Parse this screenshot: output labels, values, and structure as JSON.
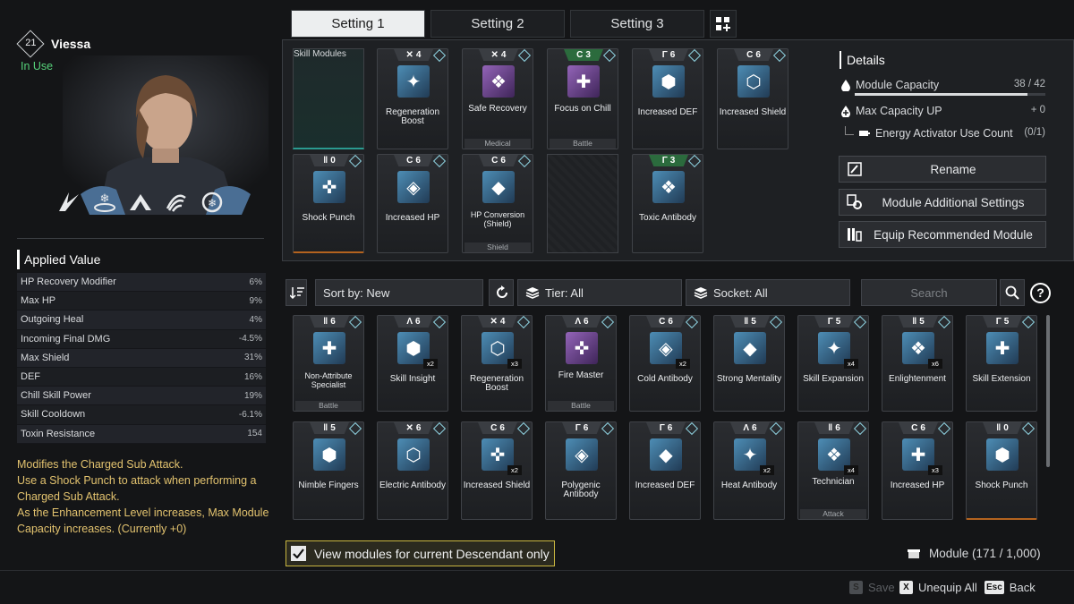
{
  "tabs": [
    "Setting 1",
    "Setting 2",
    "Setting 3"
  ],
  "character": {
    "level": "21",
    "name": "Viessa",
    "status": "In Use"
  },
  "applied": {
    "title": "Applied Value",
    "rows": [
      {
        "label": "HP Recovery Modifier",
        "value": "6%"
      },
      {
        "label": "Max HP",
        "value": "9%"
      },
      {
        "label": "Outgoing Heal",
        "value": "4%"
      },
      {
        "label": "Incoming Final DMG",
        "value": "-4.5%"
      },
      {
        "label": "Max Shield",
        "value": "31%"
      },
      {
        "label": "DEF",
        "value": "16%"
      },
      {
        "label": "Chill Skill Power",
        "value": "19%"
      },
      {
        "label": "Skill Cooldown",
        "value": "-6.1%"
      },
      {
        "label": "Toxin Resistance",
        "value": "154"
      }
    ]
  },
  "description": [
    "Modifies the Charged Sub Attack.",
    "Use a Shock Punch to attack when performing a Charged Sub Attack.",
    "As the Enhancement Level increases, Max Module Capacity increases. (Currently +0)"
  ],
  "details": {
    "title": "Details",
    "capacity_label": "Module Capacity",
    "capacity_value": "38 / 42",
    "capacity_fraction": 0.905,
    "maxcap_label": "Max Capacity UP",
    "maxcap_value": "+ 0",
    "activator_label": "Energy Activator Use Count",
    "activator_value": "(0/1)"
  },
  "actions": {
    "rename": "Rename",
    "additional": "Module Additional Settings",
    "recommended": "Equip Recommended Module"
  },
  "equipped": [
    {
      "name": "Skill Modules",
      "cost": "",
      "cat": "",
      "empty": true,
      "special": true
    },
    {
      "name": "Regeneration Boost",
      "cost": "4",
      "sym": "✕",
      "cat": ""
    },
    {
      "name": "Safe Recovery",
      "cost": "4",
      "sym": "✕",
      "cat": "Medical",
      "purple": true
    },
    {
      "name": "Focus on Chill",
      "cost": "3",
      "sym": "C",
      "cat": "Battle",
      "purple": true,
      "green": true
    },
    {
      "name": "Increased DEF",
      "cost": "6",
      "sym": "Γ",
      "cat": ""
    },
    {
      "name": "Increased Shield",
      "cost": "6",
      "sym": "C",
      "cat": ""
    },
    {
      "name": "Shock Punch",
      "cost": "0",
      "sym": "‖",
      "cat": "",
      "orange": true
    },
    {
      "name": "Increased HP",
      "cost": "6",
      "sym": "C",
      "cat": ""
    },
    {
      "name": "HP Conversion (Shield)",
      "cost": "6",
      "sym": "C",
      "cat": "Shield"
    },
    {
      "name": "",
      "empty": true
    },
    {
      "name": "Toxic Antibody",
      "cost": "3",
      "sym": "Γ",
      "cat": "",
      "green": true
    }
  ],
  "filters": {
    "sort": "Sort by: New",
    "tier": "Tier: All",
    "socket": "Socket: All",
    "search_placeholder": "Search"
  },
  "inventory": [
    {
      "name": "Non-Attribute Specialist",
      "cost": "6",
      "sym": "‖",
      "cat": "Battle",
      "count": ""
    },
    {
      "name": "Skill Insight",
      "cost": "6",
      "sym": "Λ",
      "cat": "",
      "count": "x2"
    },
    {
      "name": "Regeneration Boost",
      "cost": "4",
      "sym": "✕",
      "cat": "",
      "count": "x3"
    },
    {
      "name": "Fire Master",
      "cost": "6",
      "sym": "Λ",
      "cat": "Battle",
      "count": "",
      "purple": true
    },
    {
      "name": "Cold Antibody",
      "cost": "6",
      "sym": "C",
      "cat": "",
      "count": "x2"
    },
    {
      "name": "Strong Mentality",
      "cost": "5",
      "sym": "‖",
      "cat": "",
      "count": ""
    },
    {
      "name": "Skill Expansion",
      "cost": "5",
      "sym": "Γ",
      "cat": "",
      "count": "x4"
    },
    {
      "name": "Enlightenment",
      "cost": "5",
      "sym": "‖",
      "cat": "",
      "count": "x6"
    },
    {
      "name": "Skill Extension",
      "cost": "5",
      "sym": "Γ",
      "cat": "",
      "count": ""
    },
    {
      "name": "Nimble Fingers",
      "cost": "5",
      "sym": "‖",
      "cat": "",
      "count": ""
    },
    {
      "name": "Electric Antibody",
      "cost": "6",
      "sym": "✕",
      "cat": "",
      "count": ""
    },
    {
      "name": "Increased Shield",
      "cost": "6",
      "sym": "C",
      "cat": "",
      "count": "x2"
    },
    {
      "name": "Polygenic Antibody",
      "cost": "6",
      "sym": "Γ",
      "cat": "",
      "count": ""
    },
    {
      "name": "Increased DEF",
      "cost": "6",
      "sym": "Γ",
      "cat": "",
      "count": ""
    },
    {
      "name": "Heat Antibody",
      "cost": "6",
      "sym": "Λ",
      "cat": "",
      "count": "x2"
    },
    {
      "name": "Technician",
      "cost": "6",
      "sym": "‖",
      "cat": "Attack",
      "count": "x4"
    },
    {
      "name": "Increased HP",
      "cost": "6",
      "sym": "C",
      "cat": "",
      "count": "x3"
    },
    {
      "name": "Shock Punch",
      "cost": "0",
      "sym": "‖",
      "cat": "",
      "count": "",
      "orange": true
    }
  ],
  "view_current_only": "View modules for current Descendant only",
  "module_count": "Module (171 / 1,000)",
  "footer": {
    "save": "Save",
    "save_key": "S",
    "unequip": "Unequip All",
    "unequip_key": "X",
    "back": "Back",
    "back_key": "Esc"
  }
}
